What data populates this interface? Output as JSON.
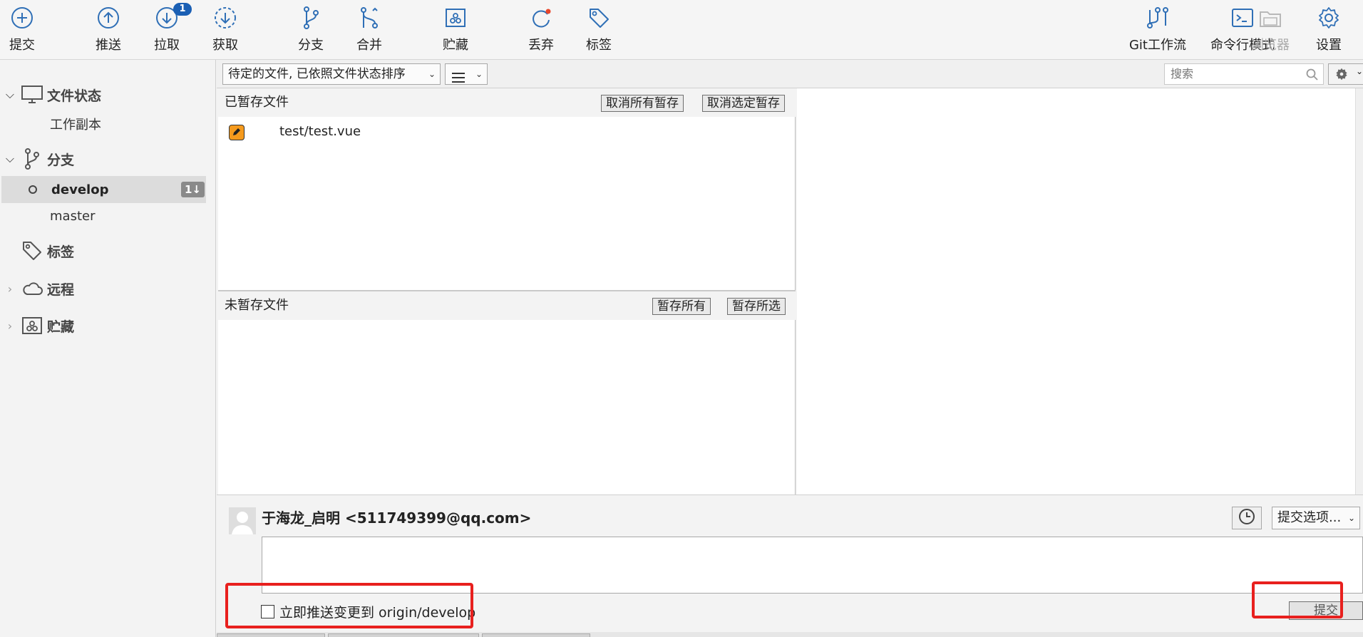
{
  "toolbar": {
    "buttons": [
      {
        "label": "提交"
      },
      {
        "label": "推送"
      },
      {
        "label": "拉取",
        "badge": "1"
      },
      {
        "label": "获取"
      },
      {
        "label": "分支"
      },
      {
        "label": "合并"
      },
      {
        "label": "贮藏"
      },
      {
        "label": "丢弃"
      },
      {
        "label": "标签"
      },
      {
        "label": "Git工作流"
      },
      {
        "label": "命令行模式"
      },
      {
        "label": "浏览器"
      },
      {
        "label": "设置"
      }
    ]
  },
  "sidebar": {
    "file_status": {
      "label": "文件状态",
      "items": [
        "工作副本"
      ]
    },
    "branches": {
      "label": "分支",
      "items": [
        {
          "name": "develop",
          "count": "1↓"
        },
        {
          "name": "master"
        }
      ]
    },
    "tags": {
      "label": "标签"
    },
    "remotes": {
      "label": "远程"
    },
    "stashes": {
      "label": "贮藏"
    }
  },
  "filterbar": {
    "sort_select": "待定的文件, 已依照文件状态排序",
    "search_placeholder": "搜索"
  },
  "staged": {
    "title": "已暂存文件",
    "unstage_all": "取消所有暂存",
    "unstage_selected": "取消选定暂存",
    "files": [
      {
        "path": "test/test.vue"
      }
    ]
  },
  "unstaged": {
    "title": "未暂存文件",
    "stage_all": "暂存所有",
    "stage_selected": "暂存所选"
  },
  "commit": {
    "author": "于海龙_启明 <511749399@qq.com>",
    "options_label": "提交选项...",
    "message": "",
    "push_label": "立即推送变更到 origin/develop",
    "submit_label": "提交"
  },
  "colors": {
    "accent": "#1a5fb4",
    "icon_blue": "#2f6fb6",
    "modified_file": "#f59a1d",
    "annotation_red": "#e8201e"
  }
}
